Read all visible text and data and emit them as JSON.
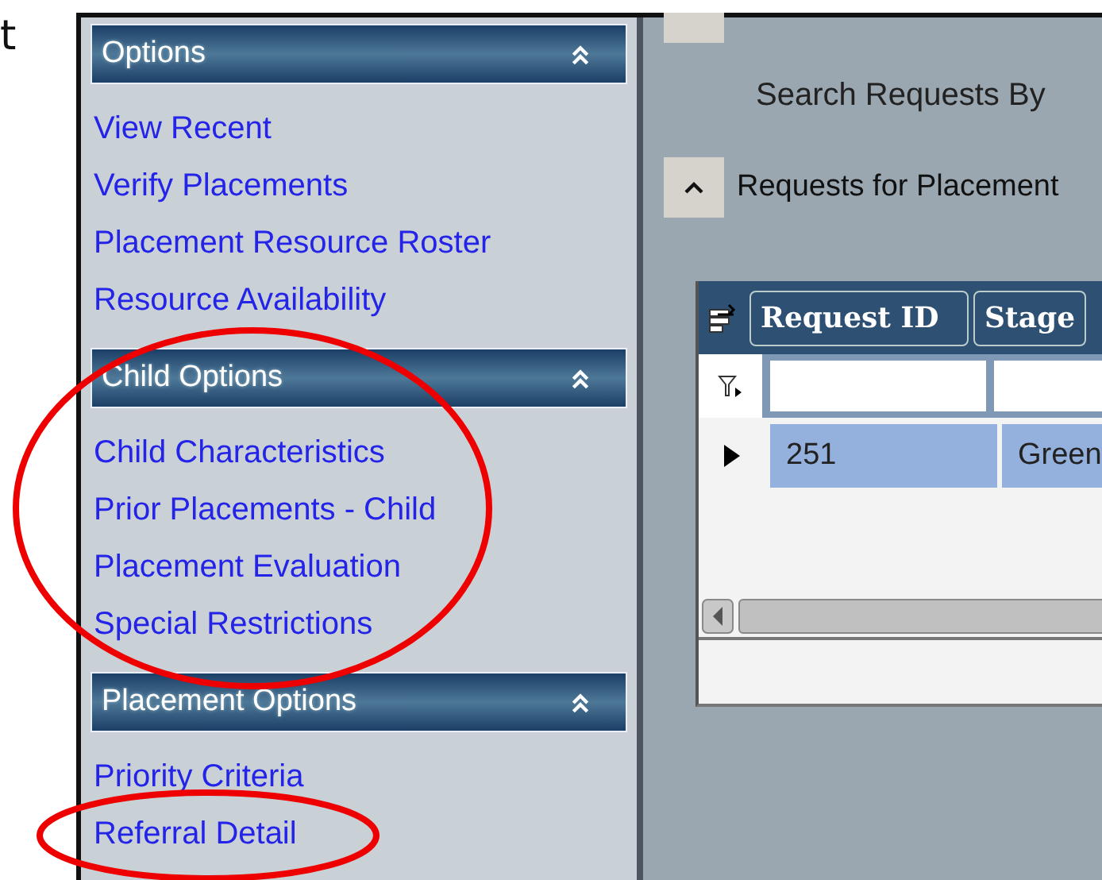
{
  "document_fragments": [
    "t"
  ],
  "sidebar": {
    "sections": [
      {
        "title": "Options",
        "expanded": true,
        "items": [
          "View Recent",
          "Verify Placements",
          "Placement Resource Roster",
          "Resource Availability"
        ]
      },
      {
        "title": "Child Options",
        "expanded": true,
        "items": [
          "Child Characteristics",
          "Prior Placements - Child",
          "Placement Evaluation",
          "Special Restrictions"
        ]
      },
      {
        "title": "Placement Options",
        "expanded": true,
        "items": [
          "Priority Criteria",
          "Referral Detail"
        ]
      }
    ]
  },
  "main": {
    "search_label": "Search Requests By",
    "section": {
      "title": "Requests for Placement",
      "expanded": true
    },
    "grid": {
      "columns": [
        "Request ID",
        "Stage"
      ],
      "rows": [
        {
          "selected": true,
          "cells": [
            "251",
            "Green"
          ]
        }
      ]
    }
  }
}
